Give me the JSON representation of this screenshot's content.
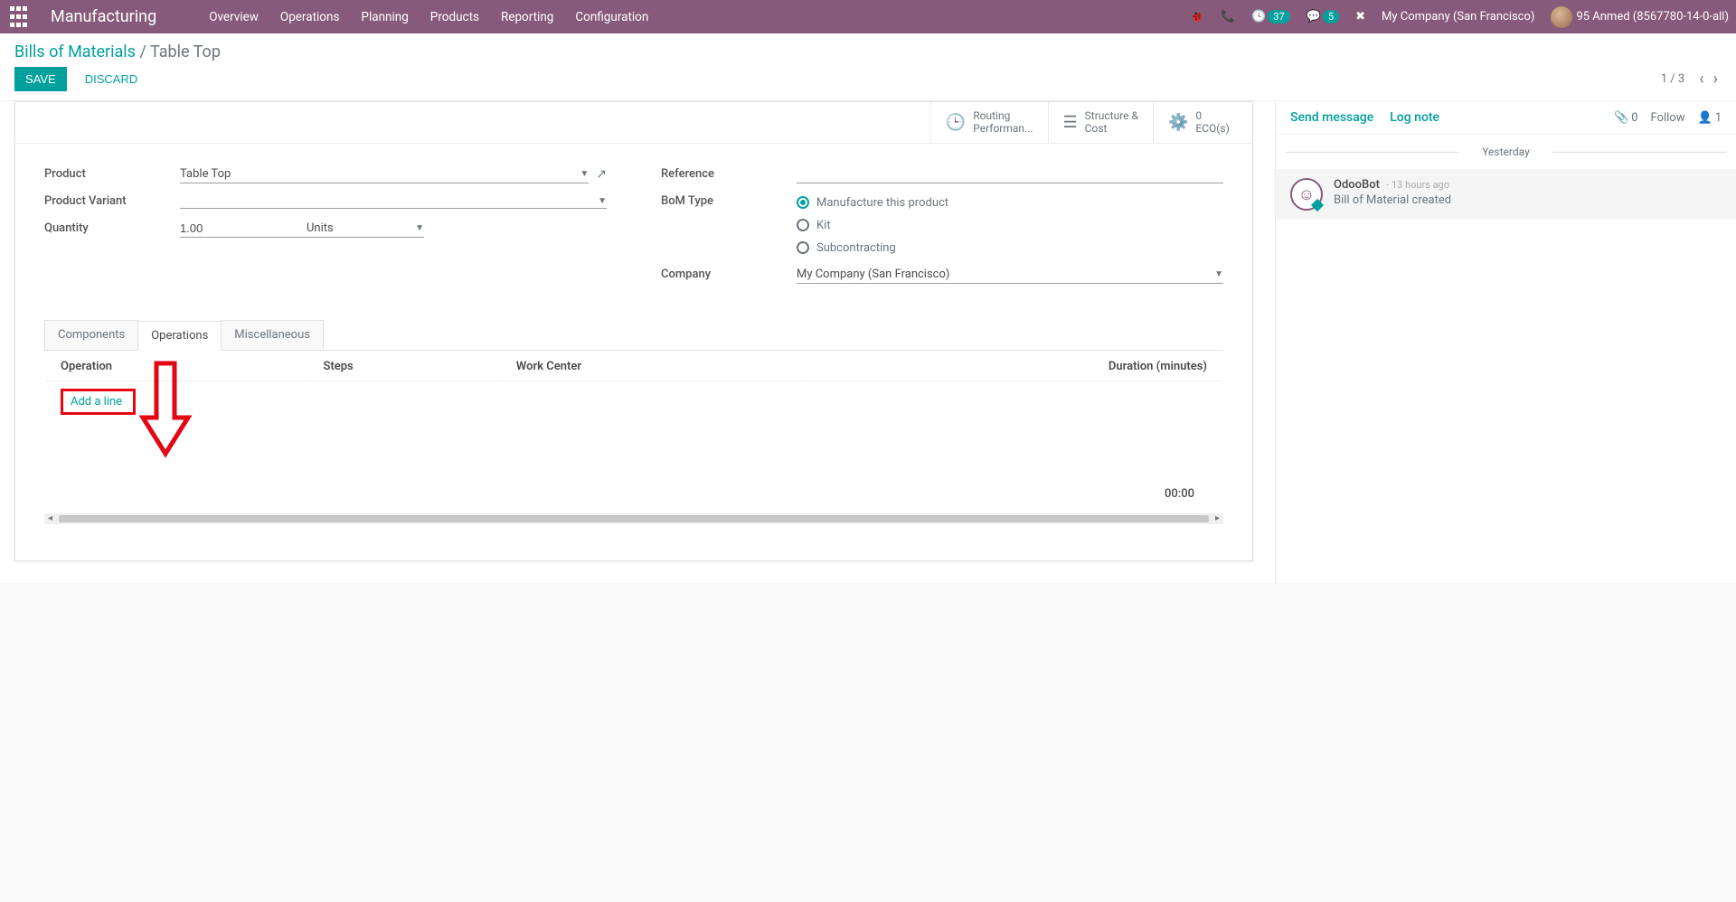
{
  "header": {
    "brand": "Manufacturing",
    "nav": [
      "Overview",
      "Operations",
      "Planning",
      "Products",
      "Reporting",
      "Configuration"
    ],
    "badge_activities": "37",
    "badge_messages": "5",
    "company": "My Company (San Francisco)",
    "user": "95 Anmed (8567780-14-0-all)"
  },
  "breadcrumb": {
    "parent": "Bills of Materials",
    "sep": "/",
    "current": "Table Top"
  },
  "buttons": {
    "save": "Save",
    "discard": "Discard"
  },
  "pager": {
    "text": "1 / 3"
  },
  "statbuttons": {
    "routing": {
      "line1": "Routing",
      "line2": "Performan..."
    },
    "structure": {
      "line1": "Structure &",
      "line2": "Cost"
    },
    "eco": {
      "line1": "0",
      "line2": "ECO(s)"
    }
  },
  "form": {
    "labels": {
      "product": "Product",
      "variant": "Product Variant",
      "quantity": "Quantity",
      "reference": "Reference",
      "bom_type": "BoM Type",
      "company": "Company"
    },
    "values": {
      "product": "Table Top",
      "variant": "",
      "quantity": "1.00",
      "quantity_uom": "Units",
      "reference": "",
      "company": "My Company (San Francisco)"
    },
    "bom_type_options": {
      "manufacture": "Manufacture this product",
      "kit": "Kit",
      "subcontract": "Subcontracting"
    }
  },
  "tabs": {
    "components": "Components",
    "operations": "Operations",
    "misc": "Miscellaneous"
  },
  "op_table": {
    "headers": {
      "operation": "Operation",
      "steps": "Steps",
      "workcenter": "Work Center",
      "duration": "Duration (minutes)"
    },
    "add_line": "Add a line",
    "total": "00:00"
  },
  "chatter": {
    "send": "Send message",
    "log": "Log note",
    "attach_count": "0",
    "follow": "Follow",
    "followers": "1",
    "day": "Yesterday",
    "msg": {
      "author": "OdooBot",
      "time": "- 13 hours ago",
      "subject": "Bill of Material created"
    }
  }
}
